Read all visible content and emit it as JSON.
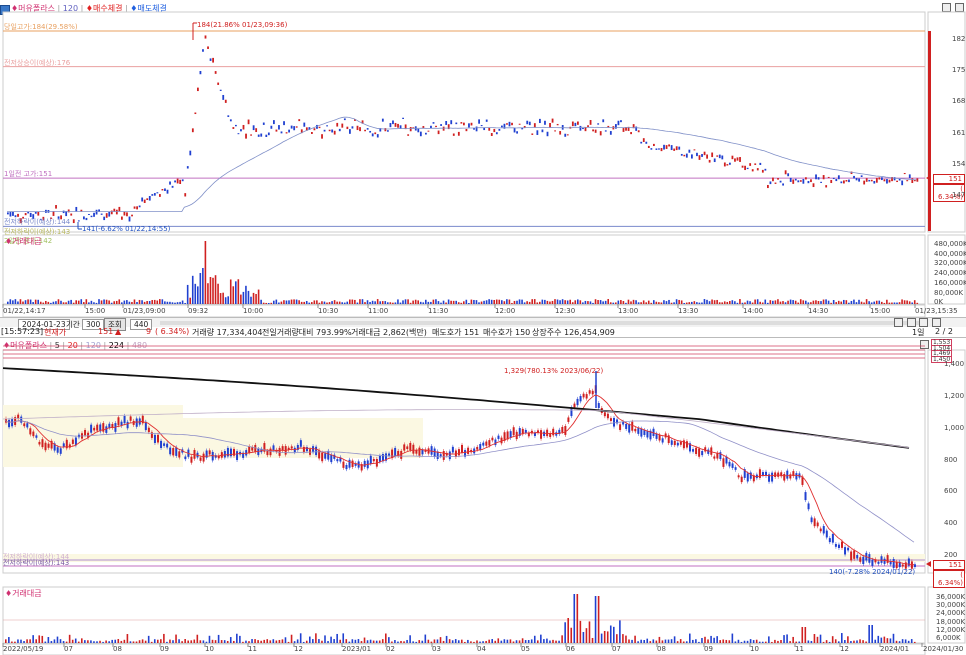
{
  "intraday": {
    "legend": {
      "name": "♦머유폴라스",
      "period": "120",
      "ma_buy": "♦매수체결",
      "ma_sell": "♦매도체결"
    },
    "hlines": [
      {
        "label": "당일고가:184(29.58%)",
        "value": 184,
        "color": "#e8a060"
      },
      {
        "label": "전저상승이(예상):176",
        "value": 176,
        "color": "#e9a0a0"
      },
      {
        "label": "1일전 고가:151",
        "value": 151,
        "color": "#c070c0"
      },
      {
        "label": "전저하락이(예상):144",
        "value": 144,
        "color": "#7a8acb"
      },
      {
        "label": "전저하락이(예상):143",
        "value": 143,
        "color": "#b8b860"
      },
      {
        "label": "2일전 종가:142",
        "value": 142,
        "color": "#a0c060"
      }
    ],
    "y_axis": [
      "182",
      "175",
      "168",
      "161",
      "154",
      "147"
    ],
    "high_annotation": "184(21.86% 01/23,09:36)",
    "low_annotation": "141(-6.62% 01/22,14:55)",
    "price_tag": {
      "price": "151",
      "pct": "( 6.34%)"
    },
    "volume_legend": "♦거래대금",
    "volume_axis": [
      "480,000K",
      "400,000K",
      "320,000K",
      "240,000K",
      "160,000K",
      "80,000K",
      "0K"
    ],
    "x_axis": [
      "01/22,14:17",
      "15:00",
      "01/23,09:00",
      "09:32",
      "10:00",
      "10:30",
      "11:00",
      "11:30",
      "12:00",
      "12:30",
      "13:00",
      "13:30",
      "14:00",
      "14:30",
      "15:00",
      "01/23,15:35"
    ]
  },
  "daily_toolbar": {
    "date": "2024-01-23",
    "period_label": "기간",
    "count": "300",
    "query": "조회",
    "zoom": "440"
  },
  "info_bar": {
    "time": "[15:57:23]",
    "label": "현재가",
    "price": "151",
    "arrow": "▲",
    "change": "9",
    "pct": "( 6.34%)",
    "volume": "거래량 17,334,404",
    "prev_vol": "전일거래량대비 793.99%",
    "amount": "거래대금 2,862(백만)",
    "ask": "매도호가 151",
    "bid": "매수호가 150",
    "shares": "상장주수 126,454,909",
    "page": "1일",
    "page_num": "2 / 2"
  },
  "daily": {
    "legend": {
      "name": "♦머유폴라스",
      "ma5": "5",
      "ma20": "20",
      "ma120": "120",
      "ma224": "224",
      "ma480": "480"
    },
    "y_axis": [
      "1,400",
      "1,200",
      "1,000",
      "800",
      "600",
      "400",
      "200"
    ],
    "right_tags": [
      "1,553",
      "1,504",
      "1,469",
      "1,450"
    ],
    "high_annotation": "1,329(780.13% 2023/06/22)",
    "low_annotation": "140(-7.28% 2024/01/22)",
    "line_label_1": "전저하락이(예상):144",
    "line_label_2": "전저하락이(예상):143",
    "price_tag": {
      "price": "151",
      "pct": "( 6.34%)"
    },
    "volume_legend": "♦거래대금",
    "volume_axis": [
      "36,000K",
      "30,000K",
      "24,000K",
      "18,000K",
      "12,000K",
      "6,000K"
    ],
    "x_axis": [
      "2022/05/19",
      "07",
      "08",
      "09",
      "10",
      "11",
      "12",
      "2023/01",
      "02",
      "03",
      "04",
      "05",
      "06",
      "07",
      "08",
      "09",
      "10",
      "11",
      "12",
      "2024/01",
      "2024/01/30"
    ]
  }
}
